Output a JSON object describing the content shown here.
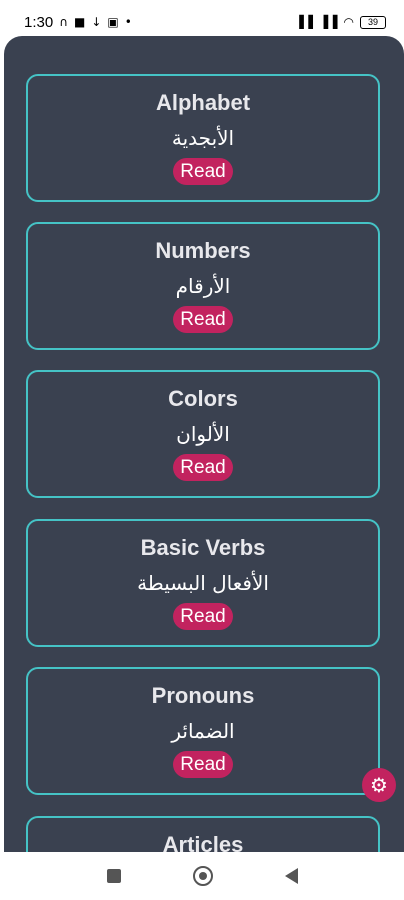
{
  "status_bar": {
    "time": "1:30",
    "battery": "39"
  },
  "cards": [
    {
      "title": "Alphabet",
      "arabic": "الأبجدية",
      "button": "Read"
    },
    {
      "title": "Numbers",
      "arabic": "الأرقام",
      "button": "Read"
    },
    {
      "title": "Colors",
      "arabic": "الألوان",
      "button": "Read"
    },
    {
      "title": "Basic Verbs",
      "arabic": "الأفعال البسيطة",
      "button": "Read"
    },
    {
      "title": "Pronouns",
      "arabic": "الضمائر",
      "button": "Read"
    },
    {
      "title": "Articles",
      "arabic": "",
      "button": ""
    }
  ],
  "icons": {
    "settings": "gear-icon",
    "nav_recent": "square-icon",
    "nav_home": "circle-icon",
    "nav_back": "triangle-back-icon"
  },
  "colors": {
    "panel_bg": "#3a4150",
    "card_border": "#45c3c6",
    "accent": "#c2235f"
  }
}
